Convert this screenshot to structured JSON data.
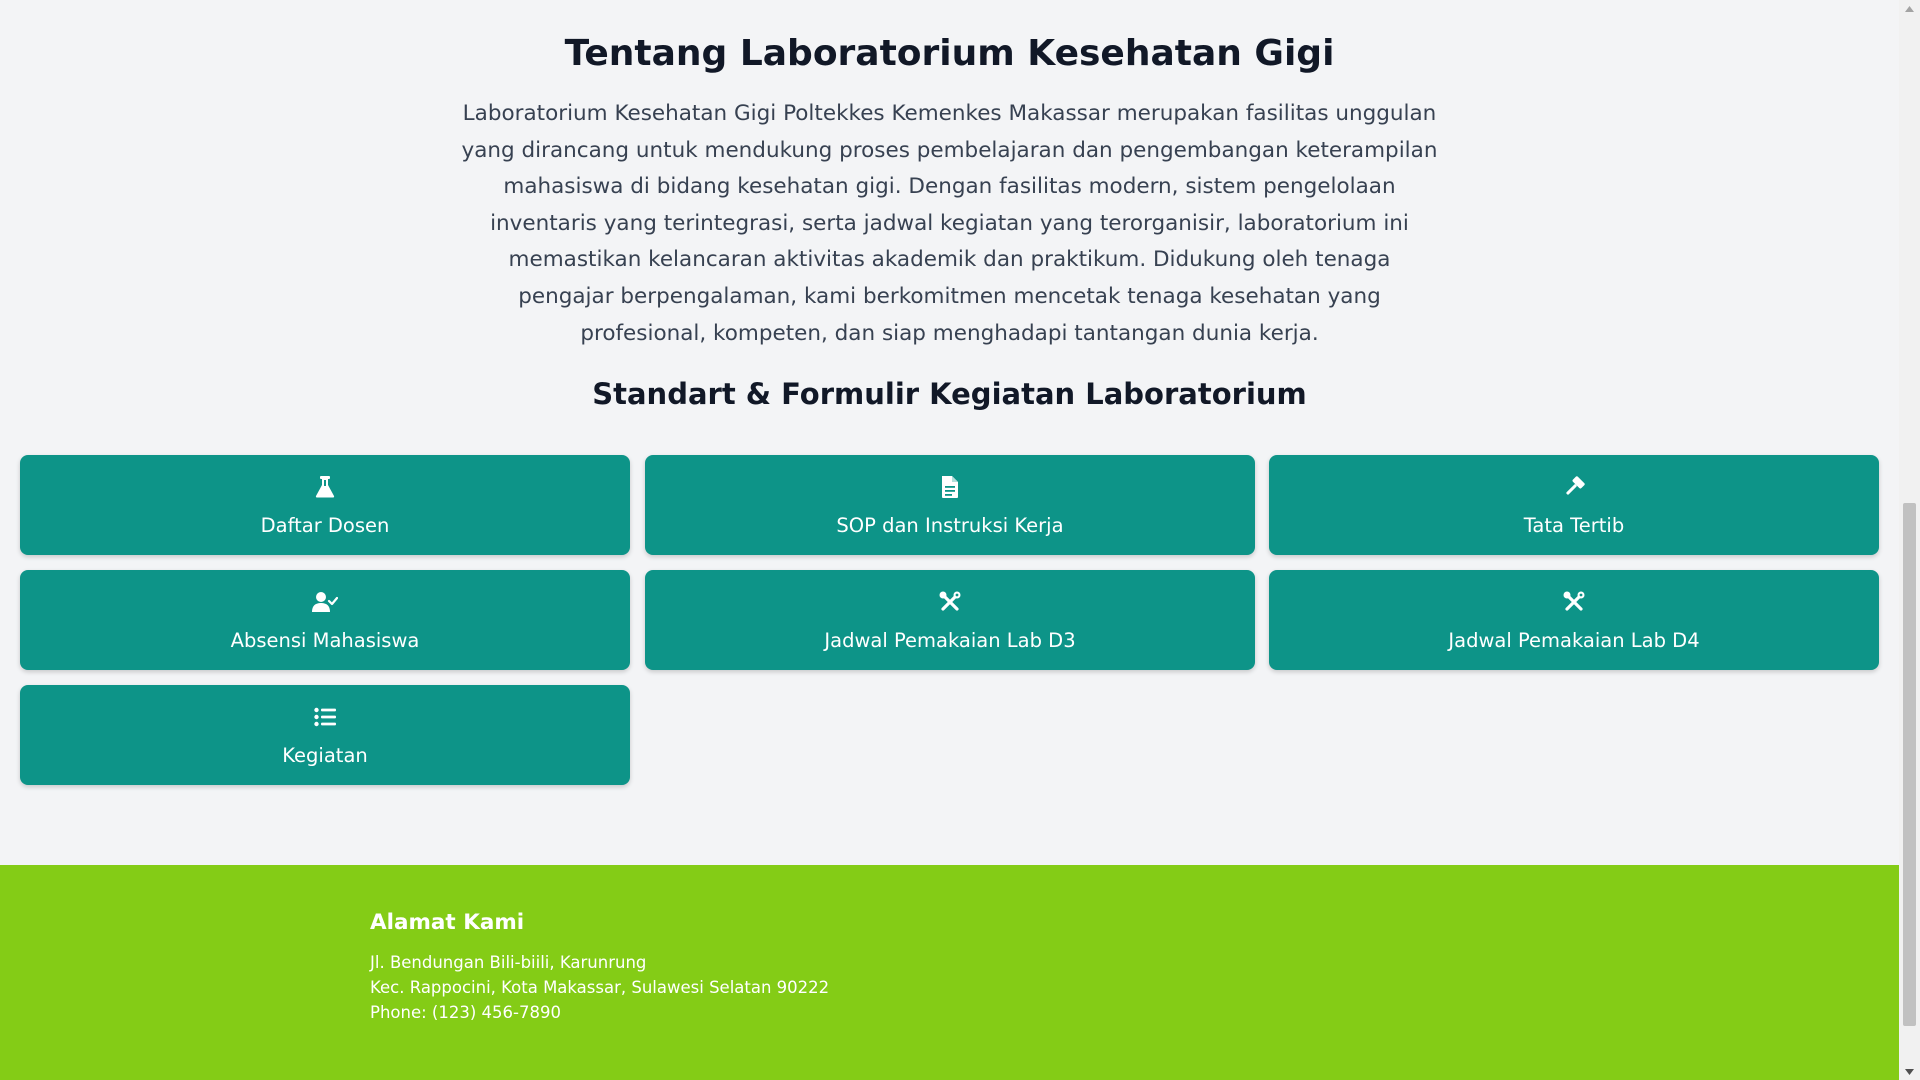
{
  "about": {
    "title": "Tentang Laboratorium Kesehatan Gigi",
    "description": "Laboratorium Kesehatan Gigi Poltekkes Kemenkes Makassar merupakan fasilitas unggulan yang dirancang untuk mendukung proses pembelajaran dan pengembangan keterampilan mahasiswa di bidang kesehatan gigi. Dengan fasilitas modern, sistem pengelolaan inventaris yang terintegrasi, serta jadwal kegiatan yang terorganisir, laboratorium ini memastikan kelancaran aktivitas akademik dan praktikum. Didukung oleh tenaga pengajar berpengalaman, kami berkomitmen mencetak tenaga kesehatan yang profesional, kompeten, dan siap menghadapi tantangan dunia kerja."
  },
  "forms_section": {
    "title": "Standart & Formulir Kegiatan Laboratorium",
    "cards": [
      {
        "label": "Daftar Dosen",
        "icon": "flask-icon"
      },
      {
        "label": "SOP dan Instruksi Kerja",
        "icon": "document-icon"
      },
      {
        "label": "Tata Tertib",
        "icon": "gavel-icon"
      },
      {
        "label": "Absensi Mahasiswa",
        "icon": "user-check-icon"
      },
      {
        "label": "Jadwal Pemakaian Lab D3",
        "icon": "tools-icon"
      },
      {
        "label": "Jadwal Pemakaian Lab D4",
        "icon": "tools-icon"
      },
      {
        "label": "Kegiatan",
        "icon": "list-icon"
      }
    ]
  },
  "footer": {
    "title": "Alamat Kami",
    "address_line1": "Jl. Bendungan Bili-biili, Karunrung",
    "address_line2": "Kec. Rappocini, Kota Makassar, Sulawesi Selatan 90222",
    "phone": "Phone: (123) 456-7890"
  },
  "colors": {
    "card_bg": "#0d9488",
    "footer_bg": "#84cc16",
    "page_bg": "#f3f4f6"
  }
}
